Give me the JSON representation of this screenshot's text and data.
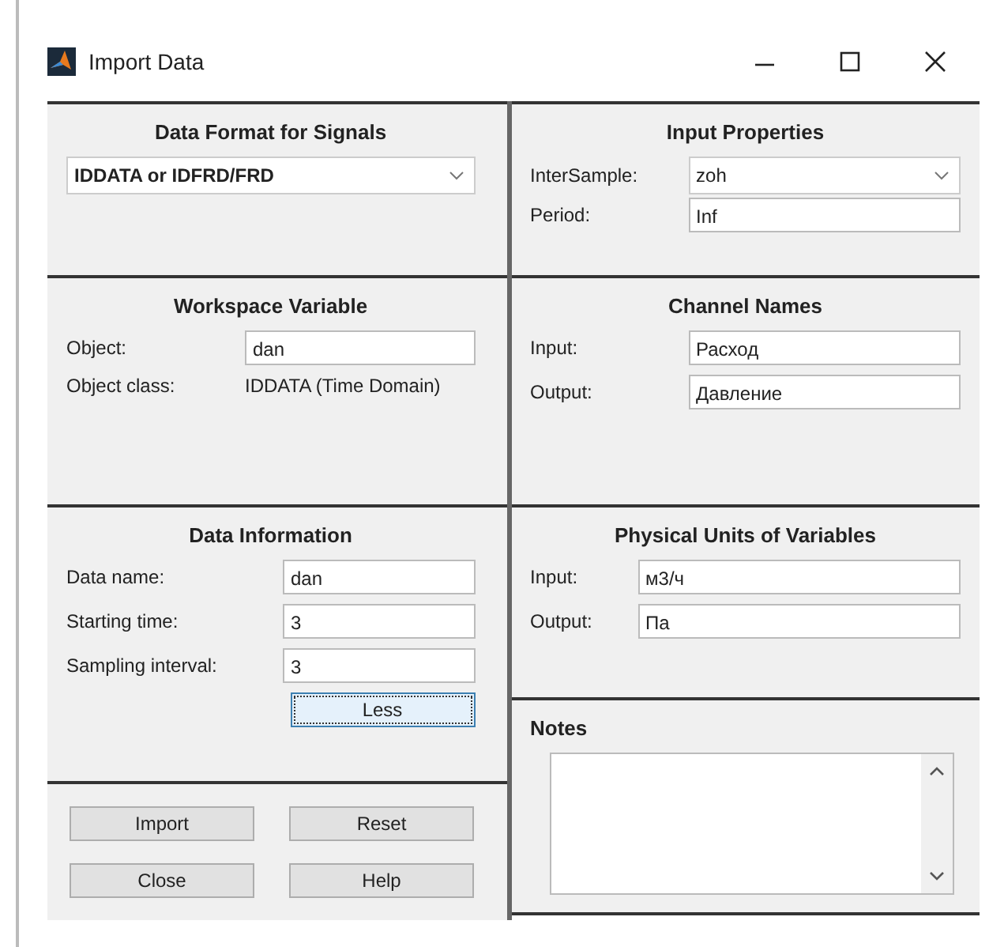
{
  "window": {
    "title": "Import Data"
  },
  "data_format": {
    "heading": "Data Format for Signals",
    "value": "IDDATA or IDFRD/FRD"
  },
  "input_properties": {
    "heading": "Input Properties",
    "fields": [
      {
        "kind": "dropdown",
        "label": "InterSample:",
        "value": "zoh"
      },
      {
        "kind": "text",
        "label": "Period:",
        "value": "Inf"
      }
    ]
  },
  "workspace_variable": {
    "heading": "Workspace Variable",
    "fields": [
      {
        "kind": "text",
        "label": "Object:",
        "value": "dan"
      },
      {
        "kind": "static",
        "label": "Object class:",
        "value": "IDDATA (Time Domain)"
      }
    ]
  },
  "channel_names": {
    "heading": "Channel Names",
    "fields": [
      {
        "kind": "text",
        "label": "Input:",
        "value": "Расход"
      },
      {
        "kind": "text",
        "label": "Output:",
        "value": "Давление"
      }
    ]
  },
  "data_information": {
    "heading": "Data Information",
    "fields": [
      {
        "kind": "text",
        "label": "Data name:",
        "value": "dan"
      },
      {
        "kind": "text",
        "label": "Starting time:",
        "value": "3"
      },
      {
        "kind": "text",
        "label": "Sampling interval:",
        "value": "3"
      }
    ],
    "button": {
      "label": "Less",
      "focused": true
    }
  },
  "physical_units": {
    "heading": "Physical Units of Variables",
    "fields": [
      {
        "kind": "text",
        "label": "Input:",
        "value": "м3/ч"
      },
      {
        "kind": "text",
        "label": "Output:",
        "value": "Па"
      }
    ]
  },
  "notes": {
    "heading": "Notes"
  },
  "buttons": [
    {
      "label": "Import"
    },
    {
      "label": "Reset"
    },
    {
      "label": "Close"
    },
    {
      "label": "Help"
    }
  ]
}
